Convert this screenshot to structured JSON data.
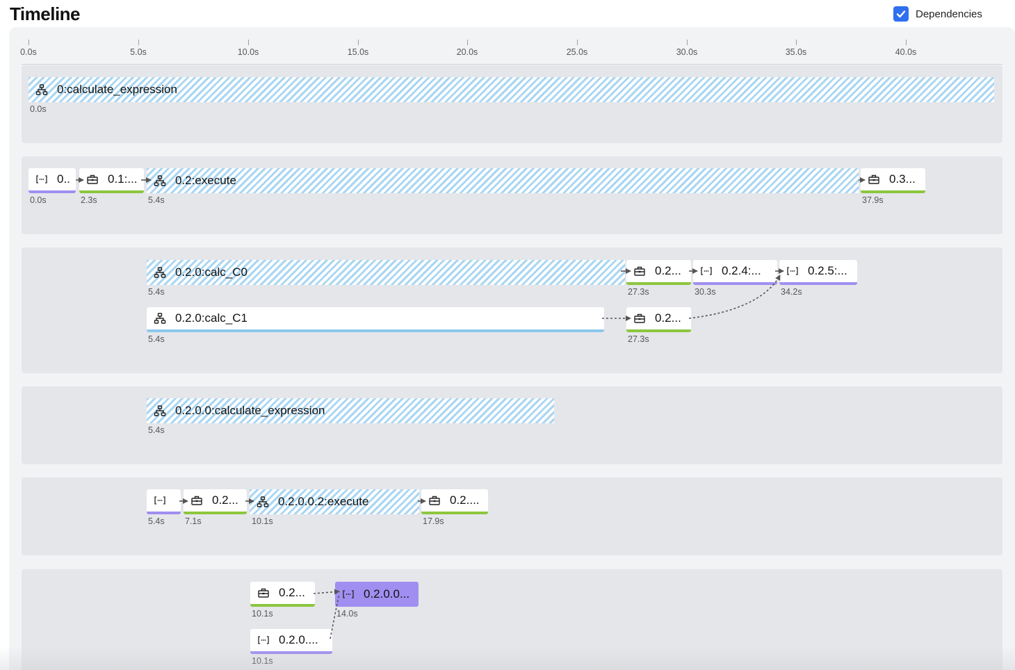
{
  "header": {
    "title": "Timeline",
    "dependencies_label": "Dependencies",
    "dependencies_checked": true
  },
  "axis": {
    "ticks": [
      "0.0s",
      "5.0s",
      "10.0s",
      "15.0s",
      "20.0s",
      "25.0s",
      "30.0s",
      "35.0s",
      "40.0s"
    ]
  },
  "colors": {
    "accent_blue": "#2f6ff0",
    "hatch_blue": "#a9d6f2",
    "task_green": "#8cc63f",
    "task_purple": "#a08ff0",
    "lane_bg": "#e5e6ea"
  },
  "lanes": [
    {
      "bars": [
        {
          "label": "0:calculate_expression",
          "start_label": "0.0s",
          "icon": "workflow-icon",
          "style": "hatched"
        }
      ]
    },
    {
      "bars": [
        {
          "label": "0..",
          "start_label": "0.0s",
          "icon": "code-brackets-icon",
          "style": "purple"
        },
        {
          "label": "0.1:...",
          "start_label": "2.3s",
          "icon": "toolbox-icon",
          "style": "green"
        },
        {
          "label": "0.2:execute",
          "start_label": "5.4s",
          "icon": "workflow-icon",
          "style": "hatched"
        },
        {
          "label": "0.3...",
          "start_label": "37.9s",
          "icon": "toolbox-icon",
          "style": "green"
        }
      ]
    },
    {
      "bars": [
        {
          "label": "0.2.0:calc_C0",
          "start_label": "5.4s",
          "icon": "workflow-icon",
          "style": "hatched"
        },
        {
          "label": "0.2...",
          "start_label": "27.3s",
          "icon": "toolbox-icon",
          "style": "green"
        },
        {
          "label": "0.2.4:...",
          "start_label": "30.3s",
          "icon": "code-brackets-icon",
          "style": "purple"
        },
        {
          "label": "0.2.5:...",
          "start_label": "34.2s",
          "icon": "code-brackets-icon",
          "style": "purple"
        },
        {
          "label": "0.2.0:calc_C1",
          "start_label": "5.4s",
          "icon": "workflow-icon",
          "style": "blue"
        },
        {
          "label": "0.2...",
          "start_label": "27.3s",
          "icon": "toolbox-icon",
          "style": "green"
        }
      ]
    },
    {
      "bars": [
        {
          "label": "0.2.0.0:calculate_expression",
          "start_label": "5.4s",
          "icon": "workflow-icon",
          "style": "hatched"
        }
      ]
    },
    {
      "bars": [
        {
          "label": "",
          "start_label": "5.4s",
          "icon": "code-brackets-icon",
          "style": "purple"
        },
        {
          "label": "0.2...",
          "start_label": "7.1s",
          "icon": "toolbox-icon",
          "style": "green"
        },
        {
          "label": "0.2.0.0.2:execute",
          "start_label": "10.1s",
          "icon": "workflow-icon",
          "style": "hatched"
        },
        {
          "label": "0.2....",
          "start_label": "17.9s",
          "icon": "toolbox-icon",
          "style": "green"
        }
      ]
    },
    {
      "bars": [
        {
          "label": "0.2...",
          "start_label": "10.1s",
          "icon": "toolbox-icon",
          "style": "green"
        },
        {
          "label": "0.2.0.0...",
          "start_label": "14.0s",
          "icon": "code-brackets-icon",
          "style": "selected-purple"
        },
        {
          "label": "0.2.0....",
          "start_label": "10.1s",
          "icon": "code-brackets-icon",
          "style": "purple"
        }
      ]
    }
  ]
}
